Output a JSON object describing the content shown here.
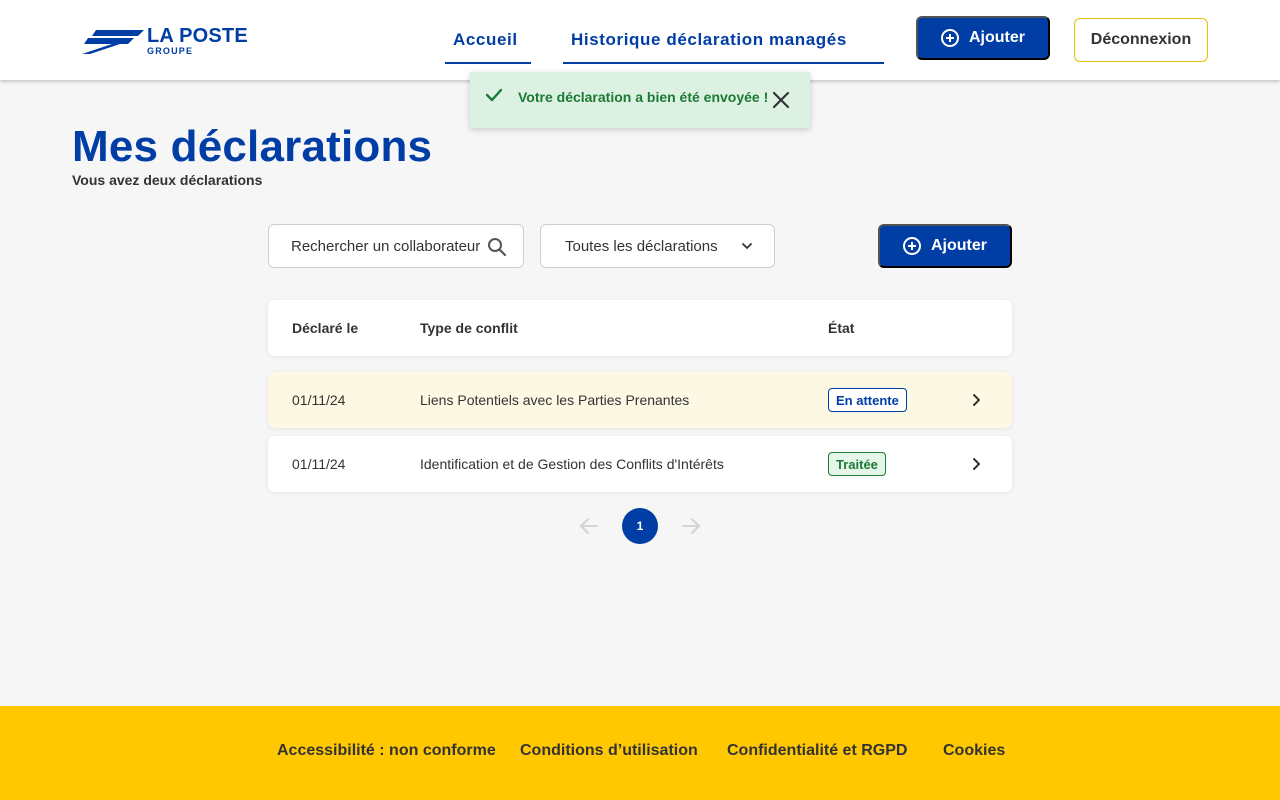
{
  "header": {
    "logo": {
      "main": "LA POSTE",
      "sub": "GROUPE"
    },
    "nav": [
      {
        "label": "Accueil"
      },
      {
        "label": "Historique déclaration managés"
      }
    ],
    "add_label": "Ajouter",
    "logout_label": "Déconnexion"
  },
  "toast": {
    "message": "Votre déclaration a bien été envoyée !"
  },
  "page": {
    "title": "Mes déclarations",
    "subtitle": "Vous avez deux déclarations"
  },
  "controls": {
    "search_placeholder": "Rechercher un collaborateur",
    "filter_value": "Toutes les déclarations",
    "add_label": "Ajouter"
  },
  "table": {
    "headers": [
      "Déclaré le",
      "Type de conflit",
      "État"
    ],
    "rows": [
      {
        "date": "01/11/24",
        "type": "Liens Potentiels avec les Parties Prenantes",
        "state": "En attente"
      },
      {
        "date": "01/11/24",
        "type": "Identification et de Gestion des Conflits d'Intérêts",
        "state": "Traitée"
      }
    ]
  },
  "pagination": {
    "current": "1"
  },
  "footer": {
    "links": [
      "Accessibilité : non conforme",
      "Conditions d’utilisation",
      "Confidentialité et RGPD",
      "Cookies"
    ]
  },
  "colors": {
    "brand": "#003da5",
    "footer": "#ffc800",
    "success": "#1a7a33",
    "pending_row": "#fdf8e4"
  }
}
